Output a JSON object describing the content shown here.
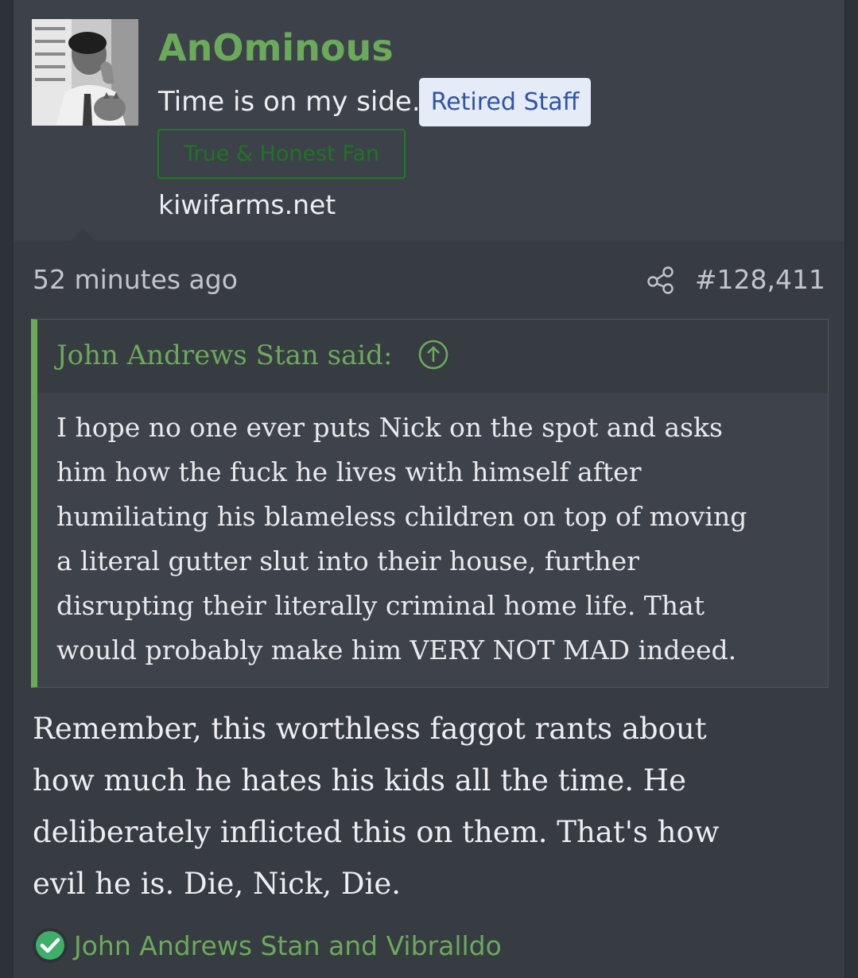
{
  "user": {
    "avatar_icon": "user-avatar-photo",
    "username": "AnOminous",
    "title": "Time is on my side.",
    "staff_badge": "Retired Staff",
    "fan_badge": "True & Honest Fan",
    "site": "kiwifarms.net"
  },
  "meta": {
    "time": "52 minutes ago",
    "share_icon": "share-icon",
    "post_number": "#128,411"
  },
  "quote": {
    "author": "John Andrews Stan said:",
    "jump_icon": "arrow-up-circle-icon",
    "lines": [
      "I hope no one ever puts Nick on the spot and asks",
      "him how the fuck he lives with himself after",
      "humiliating his blameless children on top of moving",
      "a literal gutter slut into their house, further",
      "disrupting their literally criminal home life. That",
      "would probably make him VERY NOT MAD indeed."
    ]
  },
  "message": {
    "lines": [
      "Remember, this worthless faggot rants about",
      "how much he hates his kids all the time. He",
      "deliberately inflicted this on them. That's how",
      "evil he is. Die, Nick, Die."
    ]
  },
  "reactions": {
    "icon": "checkmark-circle-icon",
    "text": "John Andrews Stan and Vibralldo"
  },
  "colors": {
    "page_bg": "#2d3138",
    "post_bg": "#373b42",
    "accent_green": "#6aaa5a",
    "staff_badge_bg": "#e6ebf8",
    "staff_badge_text": "#2f54a8",
    "fan_badge_green": "#1f7424"
  }
}
